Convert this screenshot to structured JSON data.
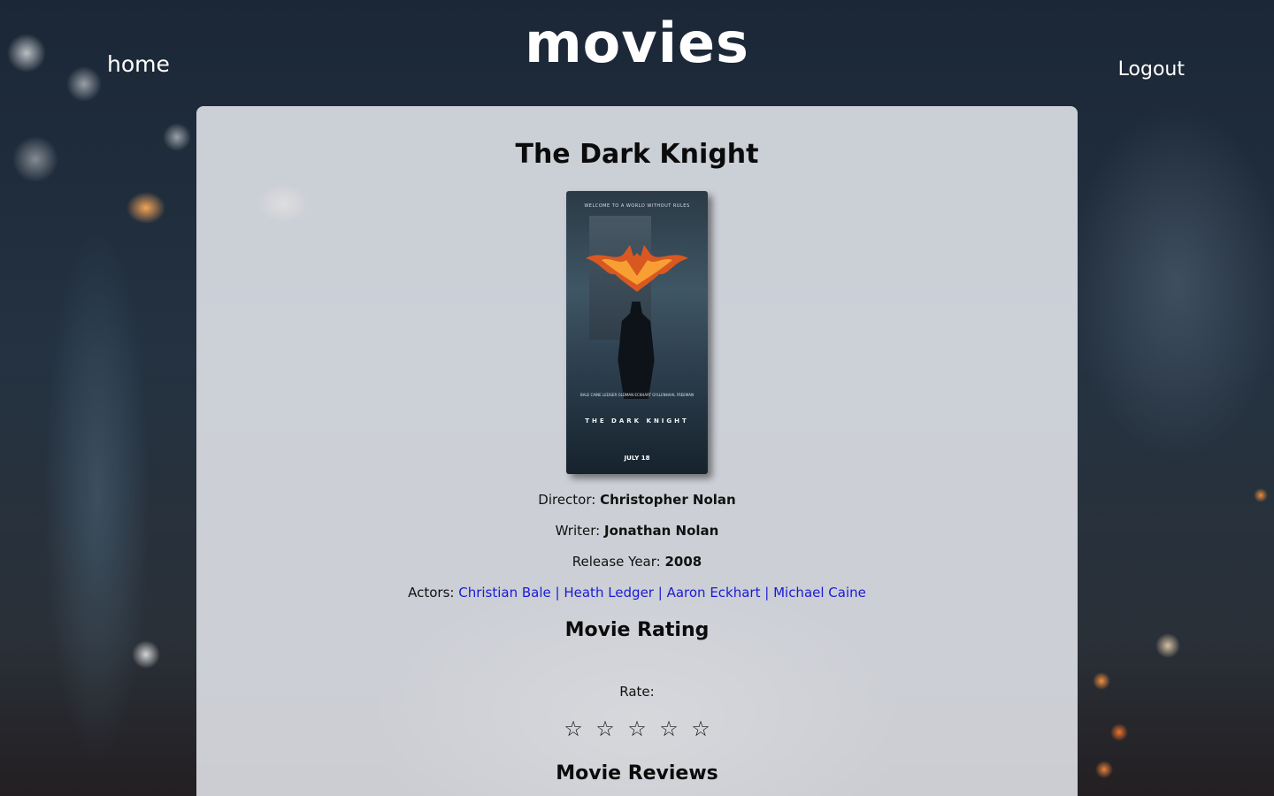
{
  "header": {
    "title": "movies",
    "home_label": "home",
    "logout_label": "Logout"
  },
  "movie": {
    "title": "The Dark Knight",
    "poster": {
      "tagline": "WELCOME TO A WORLD WITHOUT RULES",
      "credits": "BALE  CAINE  LEDGER  OLDMAN  ECKHART  GYLLENHAAL  FREEMAN",
      "title": "THE DARK KNIGHT",
      "date": "JULY 18"
    },
    "director_label": "Director:",
    "director": "Christopher Nolan",
    "writer_label": "Writer:",
    "writer": "Jonathan Nolan",
    "year_label": "Release Year:",
    "year": "2008",
    "actors_label": "Actors:",
    "actors": [
      "Christian Bale",
      "Heath Ledger",
      "Aaron Eckhart",
      "Michael Caine"
    ],
    "separator": " | "
  },
  "rating": {
    "title": "Movie Rating",
    "rate_label": "Rate:",
    "star_glyph": "☆",
    "stars_count": 5,
    "current": 0
  },
  "reviews": {
    "title": "Movie Reviews"
  },
  "colors": {
    "link": "#1a1ad6",
    "card_bg": "#e8eaf0"
  }
}
